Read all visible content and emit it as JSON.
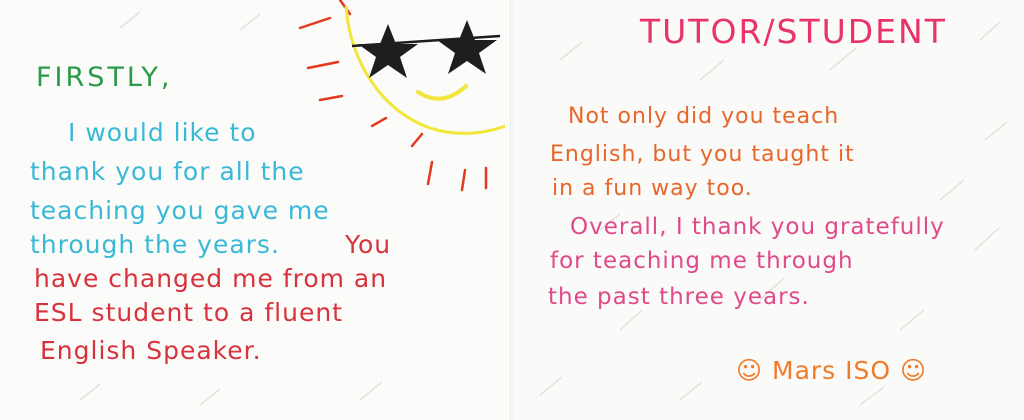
{
  "left_card": {
    "greeting": "FIRSTLY,",
    "cyan_lines": [
      "I would like to",
      "thank you for all the",
      "teaching you gave me",
      "through the years."
    ],
    "cyan_tail": "You",
    "red_lines": [
      "have changed me from an",
      "ESL student to a fluent",
      "English Speaker."
    ]
  },
  "right_card": {
    "title": "TUTOR/STUDENT",
    "orange_lines": [
      "Not only did you teach",
      "English, but you taught it",
      "in a fun way too."
    ],
    "pink_lines": [
      "Overall, I thank you gratefully",
      "for teaching me through",
      "the past three years."
    ],
    "signature": "☺ Mars ISO ☺"
  },
  "drawing": {
    "sun_color": "#f2e63a",
    "ray_color": "#e23a1c",
    "glasses_color": "#1c1c1c",
    "icon": "sun-with-star-sunglasses-icon"
  }
}
